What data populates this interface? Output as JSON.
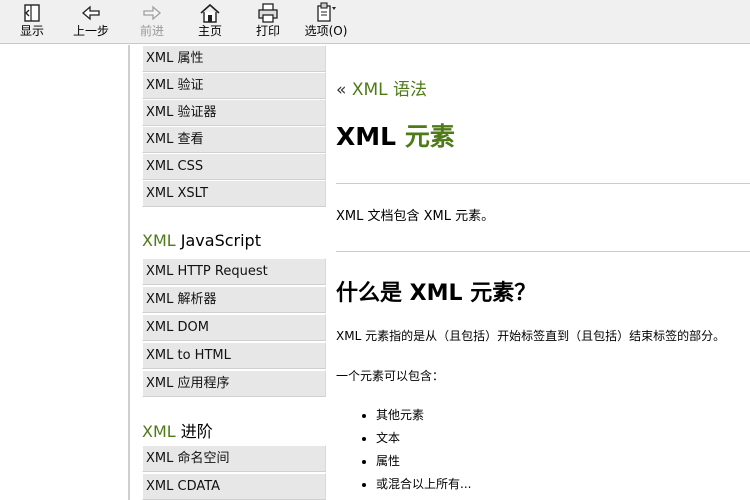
{
  "toolbar": {
    "buttons": [
      {
        "label": "显示",
        "icon": "show-pane-icon",
        "enabled": true
      },
      {
        "label": "上一步",
        "icon": "back-arrow-icon",
        "enabled": true
      },
      {
        "label": "前进",
        "icon": "forward-arrow-icon",
        "enabled": false
      },
      {
        "label": "主页",
        "icon": "home-icon",
        "enabled": true
      },
      {
        "label": "打印",
        "icon": "printer-icon",
        "enabled": true
      },
      {
        "label": "选项(O)",
        "icon": "options-icon",
        "enabled": true
      }
    ]
  },
  "sidebar": {
    "group1": [
      "XML 属性",
      "XML 验证",
      "XML 验证器",
      "XML 查看",
      "XML CSS",
      "XML XSLT"
    ],
    "heading2": {
      "prefix": "XML",
      "rest": " JavaScript"
    },
    "group2": [
      "XML HTTP Request",
      "XML 解析器",
      "XML DOM",
      "XML to HTML",
      "XML 应用程序"
    ],
    "heading3": {
      "prefix": "XML",
      "rest": " 进阶"
    },
    "group3": [
      "XML 命名空间",
      "XML CDATA"
    ]
  },
  "main": {
    "breadcrumb_marker": "«",
    "breadcrumb": "XML 语法",
    "title_prefix": "XML",
    "title_highlight": "元素",
    "intro": "XML 文档包含 XML 元素。",
    "section_heading": "什么是 XML 元素？",
    "section_text": "XML 元素指的是从（且包括）开始标签直到（且包括）结束标签的部分。",
    "can_contain": "一个元素可以包含：",
    "list": [
      "其他元素",
      "文本",
      "属性",
      "或混合以上所有..."
    ]
  },
  "colors": {
    "accent_green": "#4f7a18",
    "nav_bg": "#e7e7e7",
    "toolbar_bg": "#f0f0f0"
  }
}
